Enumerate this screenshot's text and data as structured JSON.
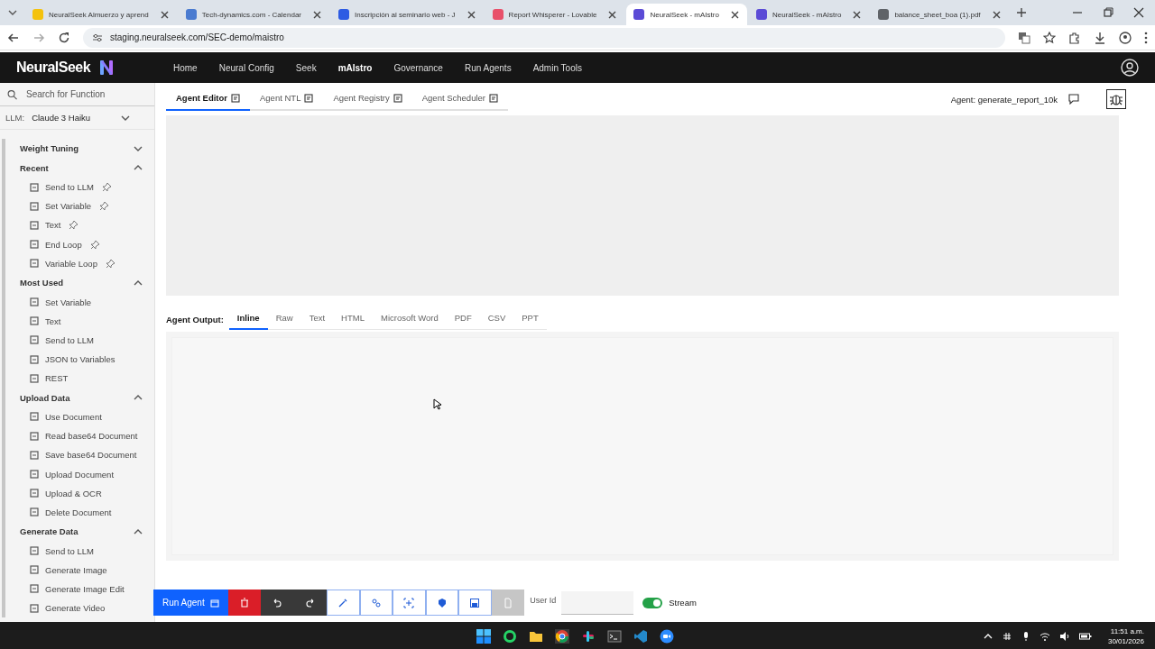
{
  "browser": {
    "tabs": [
      {
        "title": "NeuralSeek Almuerzo y aprend",
        "selected": false,
        "color": "#f4c20d"
      },
      {
        "title": "Tech-dynamics.com - Calendar",
        "selected": false,
        "color": "#4a7bd0"
      },
      {
        "title": "Inscripción al seminario web - J",
        "selected": false,
        "color": "#2d5be3"
      },
      {
        "title": "Report Whisperer - Lovable",
        "selected": false,
        "color": "#e8506a"
      },
      {
        "title": "NeuralSeek - mAIstro",
        "selected": true,
        "color": "#5b4bd6"
      },
      {
        "title": "NeuralSeek - mAIstro",
        "selected": false,
        "color": "#5b4bd6"
      },
      {
        "title": "balance_sheet_boa (1).pdf",
        "selected": false,
        "color": "#5f6368"
      }
    ],
    "address": "staging.neuralseek.com/SEC-demo/maistro"
  },
  "header": {
    "logo": "NeuralSeek",
    "nav": [
      {
        "label": "Home",
        "selected": false
      },
      {
        "label": "Neural Config",
        "selected": false
      },
      {
        "label": "Seek",
        "selected": false
      },
      {
        "label": "mAIstro",
        "selected": true
      },
      {
        "label": "Governance",
        "selected": false
      },
      {
        "label": "Run Agents",
        "selected": false
      },
      {
        "label": "Admin Tools",
        "selected": false
      }
    ]
  },
  "sidebar": {
    "search_placeholder": "Search for Function",
    "llm_label": "LLM:",
    "llm_value": "Claude 3 Haiku",
    "sections": [
      {
        "title": "Weight Tuning",
        "expanded": false
      },
      {
        "title": "Recent",
        "expanded": true,
        "items": [
          {
            "label": "Send to LLM",
            "pinned": true
          },
          {
            "label": "Set Variable",
            "pinned": true
          },
          {
            "label": "Text",
            "pinned": true
          },
          {
            "label": "End Loop",
            "pinned": true
          },
          {
            "label": "Variable Loop",
            "pinned": true
          }
        ]
      },
      {
        "title": "Most Used",
        "expanded": true,
        "items": [
          {
            "label": "Set Variable",
            "pinned": false
          },
          {
            "label": "Text",
            "pinned": false
          },
          {
            "label": "Send to LLM",
            "pinned": false
          },
          {
            "label": "JSON to Variables",
            "pinned": false
          },
          {
            "label": "REST",
            "pinned": false
          }
        ]
      },
      {
        "title": "Upload Data",
        "expanded": true,
        "items": [
          {
            "label": "Use Document",
            "pinned": false
          },
          {
            "label": "Read base64 Document",
            "pinned": false
          },
          {
            "label": "Save base64 Document",
            "pinned": false
          },
          {
            "label": "Upload Document",
            "pinned": false
          },
          {
            "label": "Upload & OCR",
            "pinned": false
          },
          {
            "label": "Delete Document",
            "pinned": false
          }
        ]
      },
      {
        "title": "Generate Data",
        "expanded": true,
        "items": [
          {
            "label": "Send to LLM",
            "pinned": false
          },
          {
            "label": "Generate Image",
            "pinned": false
          },
          {
            "label": "Generate Image Edit",
            "pinned": false
          },
          {
            "label": "Generate Video",
            "pinned": false
          }
        ]
      }
    ]
  },
  "editor": {
    "tabs": [
      {
        "label": "Agent Editor",
        "selected": true
      },
      {
        "label": "Agent NTL",
        "selected": false
      },
      {
        "label": "Agent Registry",
        "selected": false
      },
      {
        "label": "Agent Scheduler",
        "selected": false
      }
    ],
    "agent": "Agent: generate_report_10k"
  },
  "output": {
    "label": "Agent Output:",
    "tabs": [
      {
        "label": "Inline",
        "selected": true
      },
      {
        "label": "Raw",
        "selected": false
      },
      {
        "label": "Text",
        "selected": false
      },
      {
        "label": "HTML",
        "selected": false
      },
      {
        "label": "Microsoft Word",
        "selected": false
      },
      {
        "label": "PDF",
        "selected": false
      },
      {
        "label": "CSV",
        "selected": false
      },
      {
        "label": "PPT",
        "selected": false
      }
    ]
  },
  "toolbar": {
    "run_label": "Run Agent",
    "user_id_label": "User Id",
    "stream": {
      "label": "Stream",
      "on": true
    }
  },
  "taskbar": {
    "time": "11:51 a.m.",
    "date": "30/01/2026"
  }
}
